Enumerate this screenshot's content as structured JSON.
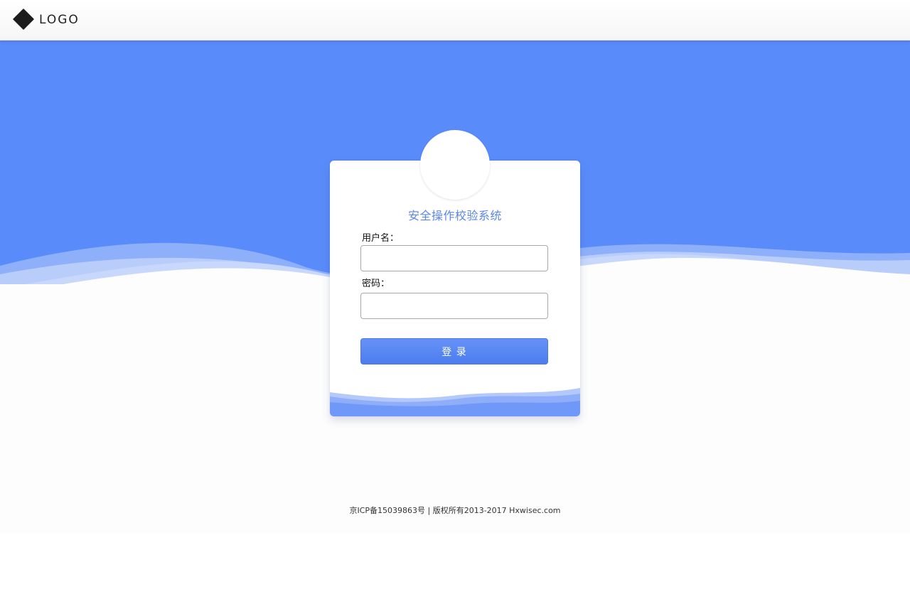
{
  "header": {
    "logo_text": "LOGO",
    "logo_icon": "diamond-logo-icon"
  },
  "colors": {
    "primary": "#5a8bfa",
    "title": "#5a86e6",
    "button": "#4c7cf0"
  },
  "login": {
    "avatar_icon": "avatar-placeholder",
    "title": "安全操作校验系统",
    "username_label": "用户名：",
    "username_value": "",
    "password_label": "密码：",
    "password_value": "",
    "submit_label": "登 录"
  },
  "footer": {
    "text": "京ICP备15039863号 | 版权所有2013-2017 Hxwisec.com"
  }
}
